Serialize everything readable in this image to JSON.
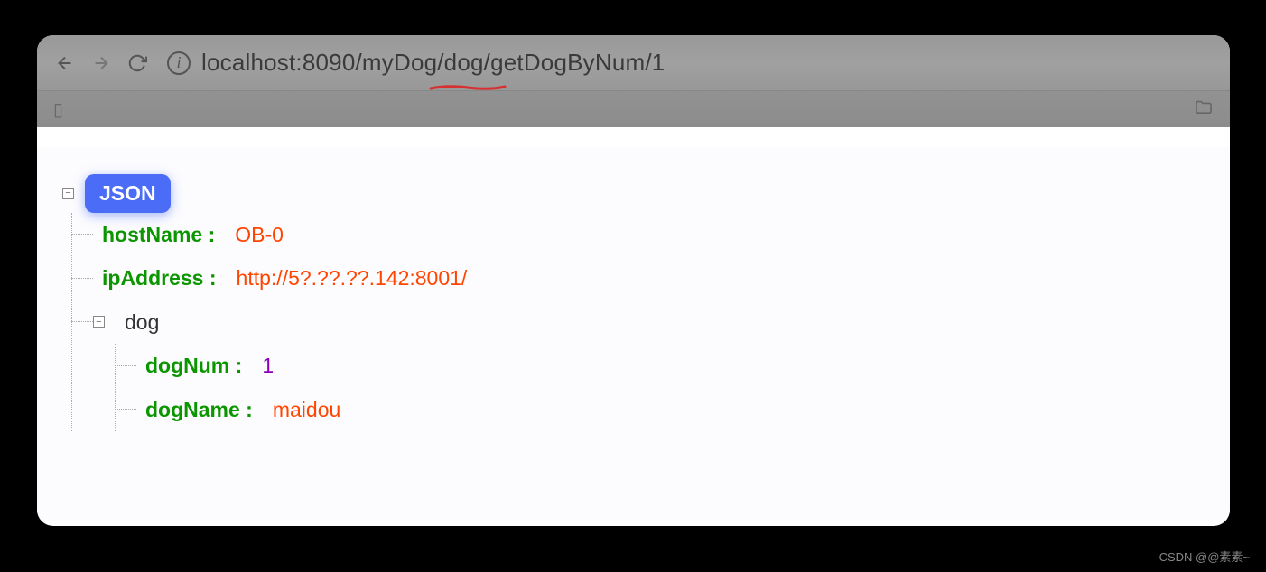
{
  "browser": {
    "url": "localhost:8090/myDog/dog/getDogByNum/1"
  },
  "json_viewer": {
    "badge_label": "JSON",
    "root": {
      "hostName": {
        "key": "hostName :",
        "value": "OB-0",
        "type": "string"
      },
      "ipAddress": {
        "key": "ipAddress :",
        "value": "http://5?.??.??.142:8001/",
        "type": "string"
      },
      "dog": {
        "key": "dog",
        "children": {
          "dogNum": {
            "key": "dogNum :",
            "value": "1",
            "type": "number"
          },
          "dogName": {
            "key": "dogName :",
            "value": "maidou",
            "type": "string"
          }
        }
      }
    }
  },
  "watermark": "CSDN @@素素~"
}
